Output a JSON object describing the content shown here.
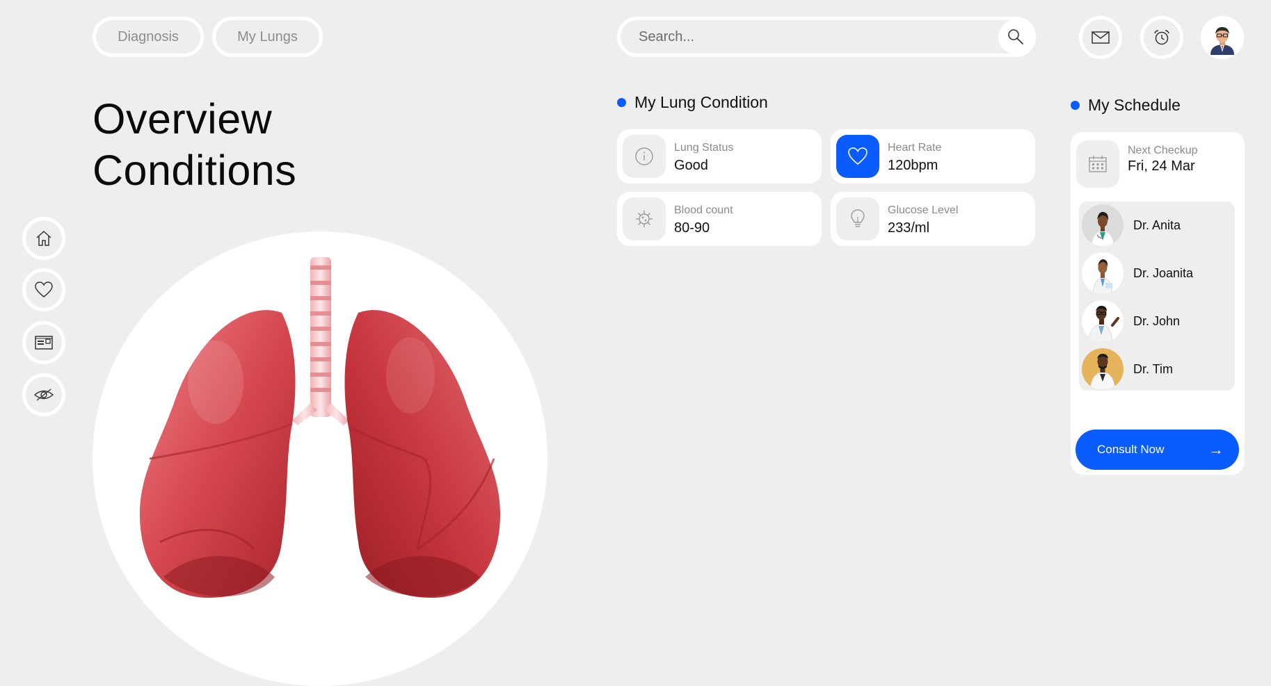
{
  "nav": {
    "tabs": [
      {
        "label": "Diagnosis"
      },
      {
        "label": "My Lungs"
      }
    ]
  },
  "search": {
    "placeholder": "Search..."
  },
  "header": {
    "icons": [
      "mail-icon",
      "alarm-clock-icon",
      "user-avatar"
    ]
  },
  "overview": {
    "title_line1": "Overview",
    "title_line2": "Conditions"
  },
  "sidebar": {
    "items": [
      "home-icon",
      "heart-icon",
      "card-icon",
      "eye-off-icon"
    ]
  },
  "lung_condition": {
    "title": "My Lung Condition",
    "cards": [
      {
        "label": "Lung Status",
        "value": "Good",
        "icon": "info-icon"
      },
      {
        "label": "Heart Rate",
        "value": "120bpm",
        "icon": "heart-icon"
      },
      {
        "label": "Blood count",
        "value": "80-90",
        "icon": "virus-icon"
      },
      {
        "label": "Glucose Level",
        "value": "233/ml",
        "icon": "lightbulb-icon"
      }
    ]
  },
  "schedule": {
    "title": "My Schedule",
    "next_label": "Next Checkup",
    "next_value": "Fri, 24 Mar",
    "doctors": [
      {
        "name": "Dr. Anita"
      },
      {
        "name": "Dr. Joanita"
      },
      {
        "name": "Dr. John"
      },
      {
        "name": "Dr. Tim"
      }
    ],
    "cta": "Consult Now"
  },
  "colors": {
    "accent": "#0a5cff",
    "background": "#eeeeee",
    "card": "#ffffff",
    "lung": "#c7373f"
  }
}
